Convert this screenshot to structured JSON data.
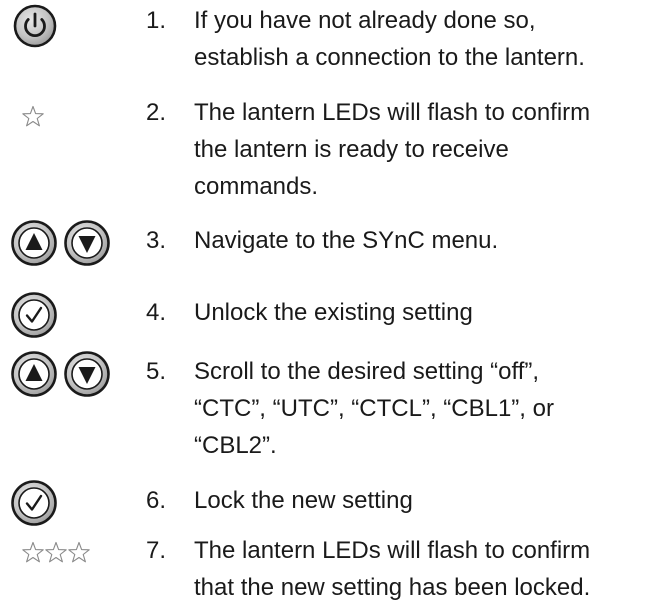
{
  "steps": [
    {
      "number": "1.",
      "text": "If you have not already done so,\nestablish a connection to the lantern.",
      "icons": [
        "power-button-icon"
      ]
    },
    {
      "number": "2.",
      "text": "The lantern LEDs will flash to confirm\nthe lantern is ready to receive\ncommands.",
      "icons": [
        "star-icon"
      ]
    },
    {
      "number": "3.",
      "text": "Navigate to the SYnC menu.",
      "icons": [
        "up-arrow-button-icon",
        "down-arrow-button-icon"
      ]
    },
    {
      "number": "4.",
      "text": "Unlock the existing setting",
      "icons": [
        "check-button-icon"
      ]
    },
    {
      "number": "5.",
      "text": "Scroll to the desired setting “off”,\n“CTC”, “UTC”, “CTCL”, “CBL1”, or\n“CBL2”.",
      "icons": [
        "up-arrow-button-icon",
        "down-arrow-button-icon"
      ]
    },
    {
      "number": "6.",
      "text": "Lock the new setting",
      "icons": [
        "check-button-icon"
      ]
    },
    {
      "number": "7.",
      "text": "The lantern LEDs will flash to confirm\nthat the new setting has been locked.",
      "icons": [
        "star-icon",
        "star-icon",
        "star-icon"
      ]
    }
  ]
}
